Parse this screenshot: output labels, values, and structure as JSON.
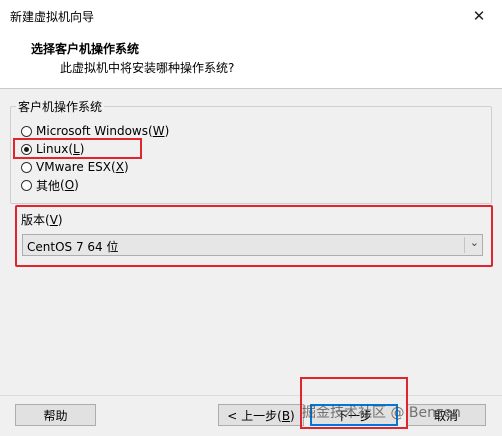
{
  "window": {
    "title": "新建虚拟机向导",
    "close_glyph": "✕"
  },
  "header": {
    "title": "选择客户机操作系统",
    "subtitle": "此虚拟机中将安装哪种操作系统?"
  },
  "os_group": {
    "label": "客户机操作系统",
    "options": [
      {
        "label": "Microsoft Windows",
        "mnemonic": "W",
        "checked": false
      },
      {
        "label": "Linux",
        "mnemonic": "L",
        "checked": true
      },
      {
        "label": "VMware ESX",
        "mnemonic": "X",
        "checked": false
      },
      {
        "label": "其他",
        "mnemonic": "O",
        "checked": false
      }
    ]
  },
  "version": {
    "label": "版本",
    "mnemonic": "V",
    "selected": "CentOS 7 64 位"
  },
  "buttons": {
    "help": "帮助",
    "back": "< 上一步",
    "back_mnemonic": "B",
    "next": "下一步",
    "cancel": "取消"
  },
  "watermark": "掘金技术社区 @ Benzen",
  "highlight_color": "#e0252f",
  "focus_color": "#0078d7"
}
